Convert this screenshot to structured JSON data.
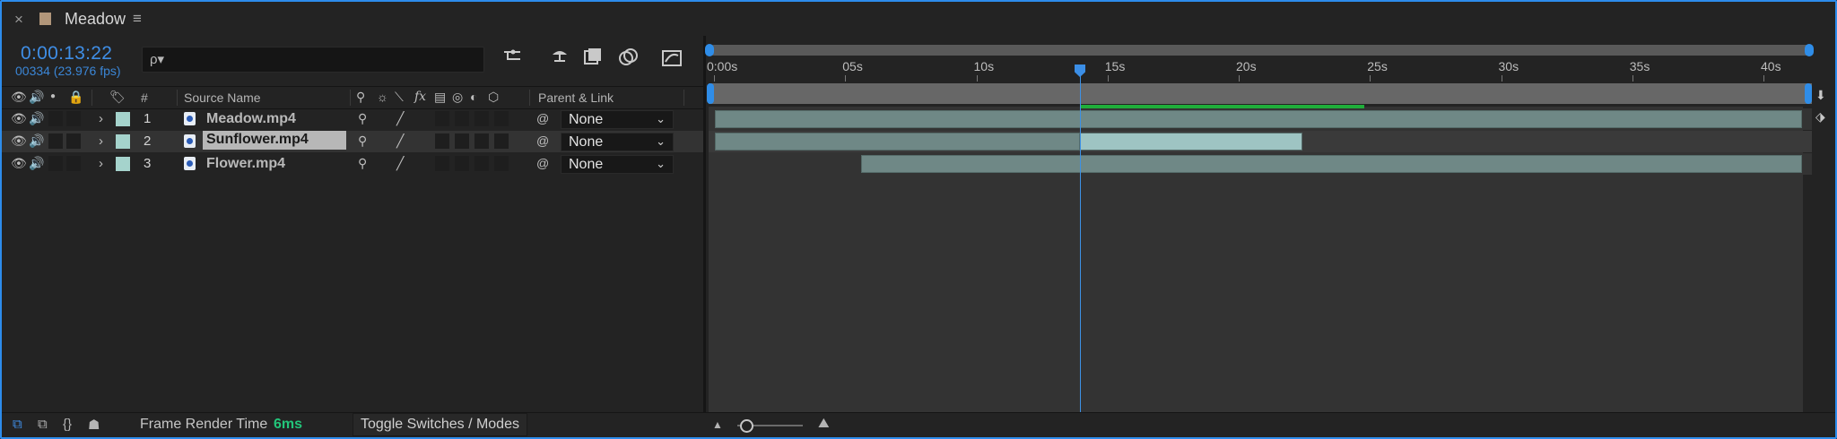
{
  "window": {
    "close_glyph": "×",
    "title": "Meadow",
    "menu_glyph": "≡",
    "swatch_color": "#b1967a"
  },
  "header": {
    "timecode": "0:00:13:22",
    "frame_info": "00334 (23.976 fps)",
    "search_placeholder": "",
    "search_icon": "ρ▾"
  },
  "columns": {
    "source_name": "Source Name",
    "number": "#",
    "parent_link": "Parent & Link",
    "fx_label": "fx"
  },
  "layers": [
    {
      "num": "1",
      "name": "Meadow.mp4",
      "parent": "None",
      "label_color": "#a5d3cc",
      "selected": false
    },
    {
      "num": "2",
      "name": "Sunflower.mp4",
      "parent": "None",
      "label_color": "#a5d3cc",
      "selected": true
    },
    {
      "num": "3",
      "name": "Flower.mp4",
      "parent": "None",
      "label_color": "#a5d3cc",
      "selected": false
    }
  ],
  "ruler": {
    "ticks": [
      "0:00s",
      "05s",
      "10s",
      "15s",
      "20s",
      "25s",
      "30s",
      "35s",
      "40s"
    ],
    "current_time_seconds": 13.92,
    "duration_seconds": 41.5
  },
  "footer": {
    "frame_render_label": "Frame Render Time",
    "frame_render_value": "6ms",
    "toggle_label": "Toggle Switches / Modes"
  },
  "colors": {
    "accent": "#2d8ceb",
    "render_value": "#23c57a",
    "label": "#a5d3cc"
  }
}
